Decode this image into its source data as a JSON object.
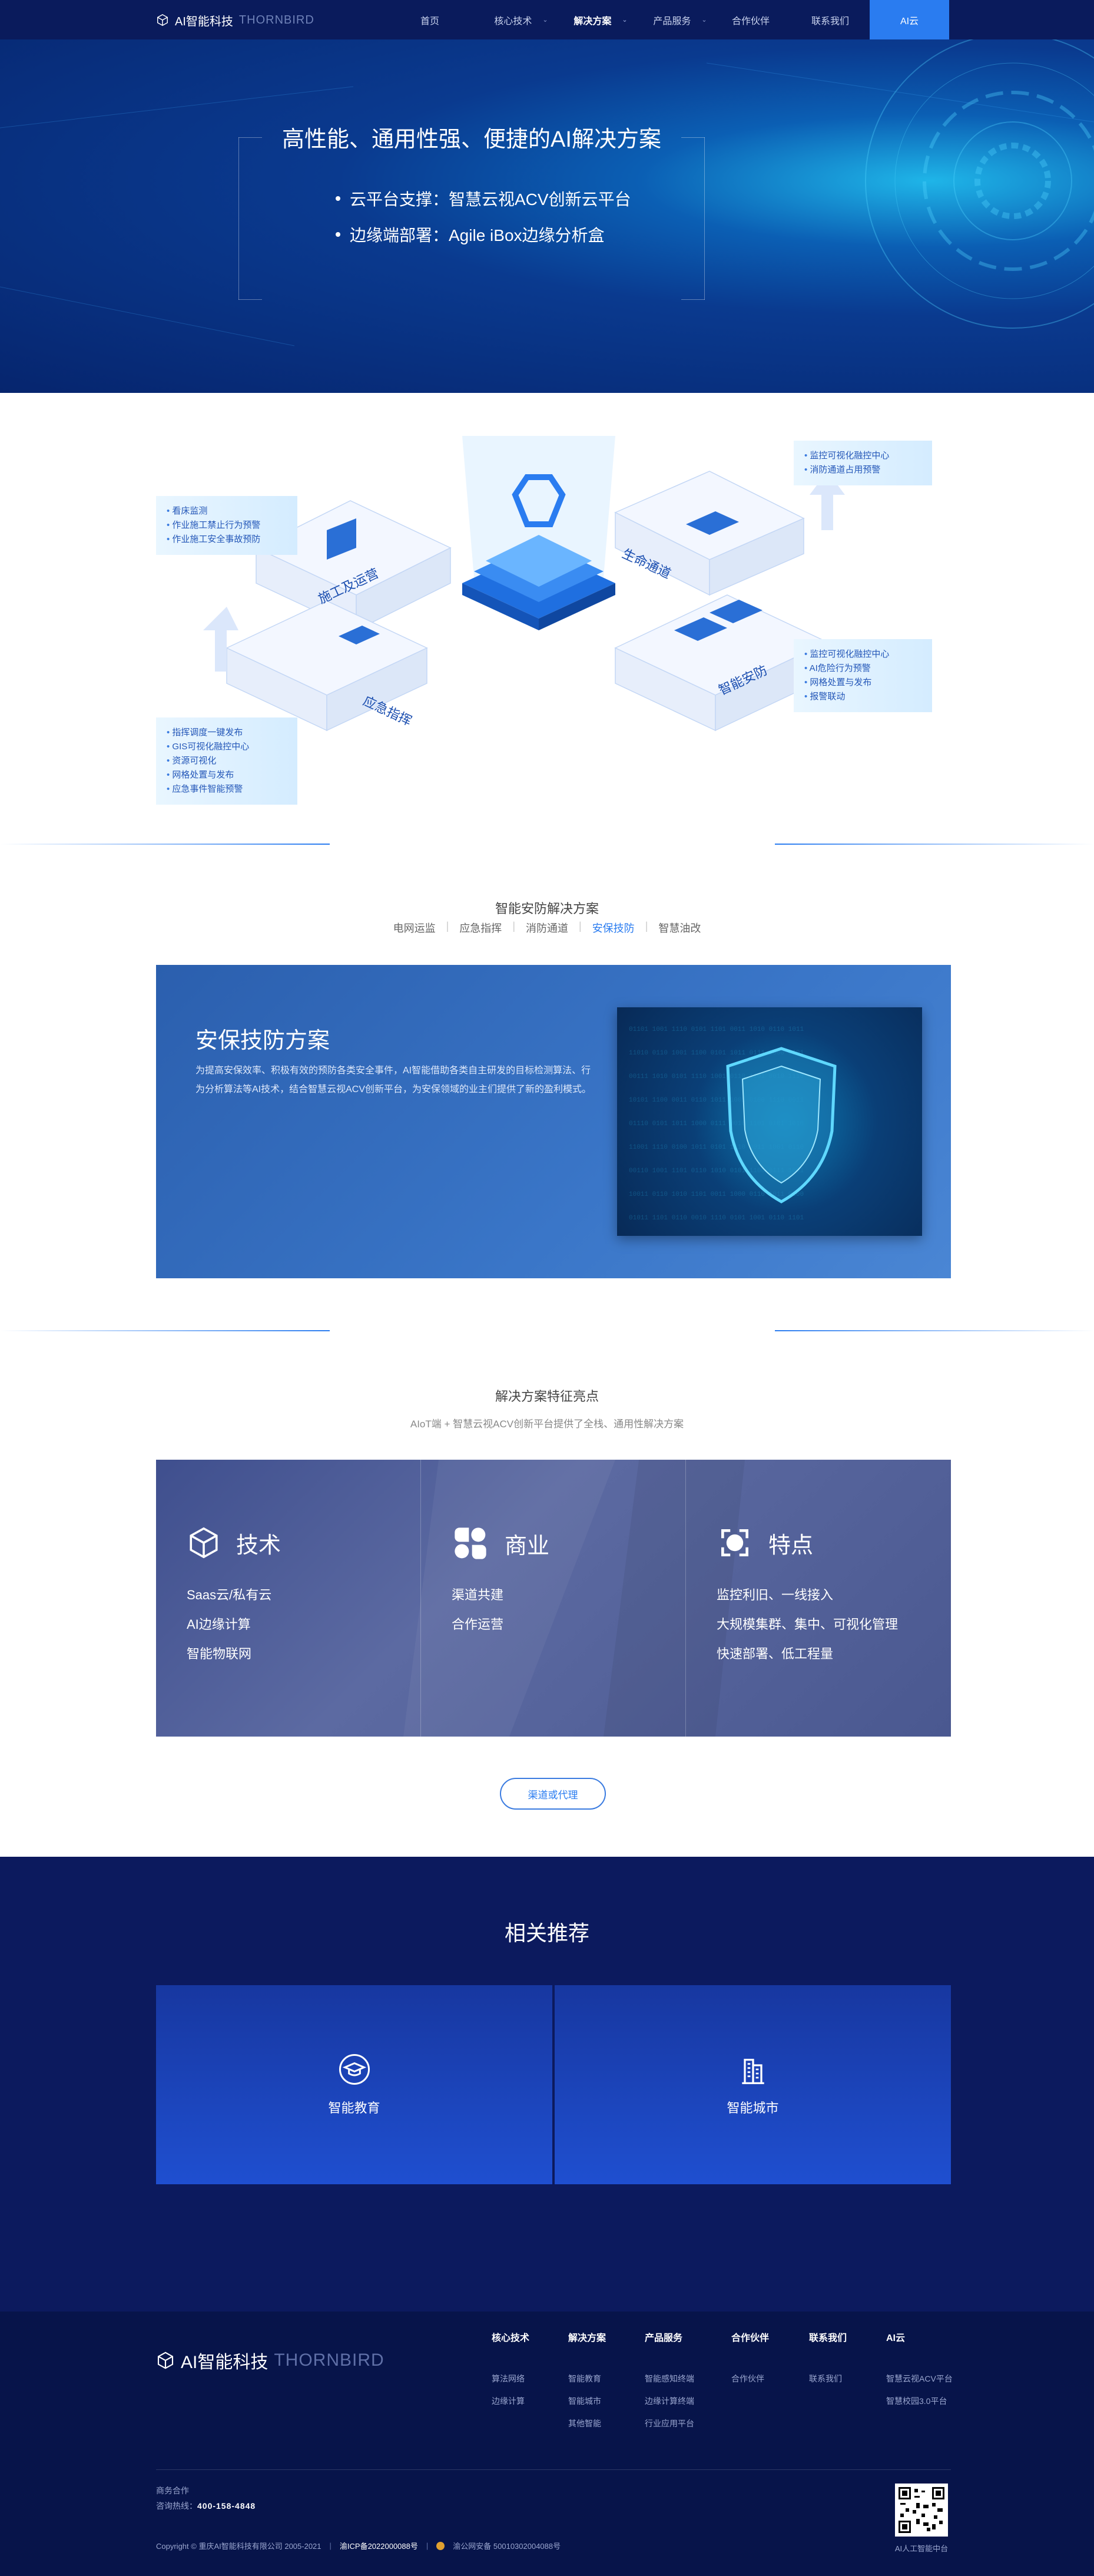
{
  "nav": {
    "logo_cn": "AI智能科技",
    "logo_en": "THORNBIRD",
    "items": [
      "首页",
      "核心技术",
      "解决方案",
      "产品服务",
      "合作伙伴",
      "联系我们",
      "AI云"
    ]
  },
  "hero": {
    "title": "高性能、通用性强、便捷的AI解决方案",
    "bullets": [
      "云平台支撑：智慧云视ACV创新云平台",
      "边缘端部署：Agile iBox边缘分析盒"
    ]
  },
  "diagram": {
    "labels": [
      "施工及运营",
      "生命通道",
      "应急指挥",
      "智能安防"
    ],
    "callout_top_left": [
      "看床监测",
      "作业施工禁止行为预警",
      "作业施工安全事故预防"
    ],
    "callout_top_right": [
      "监控可视化融控中心",
      "消防通道占用预警"
    ],
    "callout_bottom_left": [
      "指挥调度一键发布",
      "GIS可视化融控中心",
      "资源可视化",
      "网格处置与发布",
      "应急事件智能预警"
    ],
    "callout_bottom_right": [
      "监控可视化融控中心",
      "AI危险行为预警",
      "网格处置与发布",
      "报警联动"
    ]
  },
  "solutions": {
    "title": "智能安防解决方案",
    "tabs": [
      "电网运监",
      "应急指挥",
      "消防通道",
      "安保技防",
      "智慧油改"
    ],
    "active_tab": 3,
    "panel_title": "安保技防方案",
    "panel_desc": "为提高安保效率、积极有效的预防各类安全事件，AI智能借助各类自主研发的目标检测算法、行为分析算法等AI技术，结合智慧云视ACV创新平台，为安保领域的业主们提供了新的盈利模式。"
  },
  "features": {
    "title": "解决方案特征亮点",
    "subtitle": "AIoT端 + 智慧云视ACV创新平台提供了全栈、通用性解决方案",
    "cols": [
      {
        "name": "技术",
        "items": [
          "Saas云/私有云",
          "AI边缘计算",
          "智能物联网"
        ]
      },
      {
        "name": "商业",
        "items": [
          "渠道共建",
          "合作运营"
        ]
      },
      {
        "name": "特点",
        "items": [
          "监控利旧、一线接入",
          "大规模集群、集中、可视化管理",
          "快速部署、低工程量"
        ]
      }
    ],
    "cta": "渠道或代理"
  },
  "related": {
    "title": "相关推荐",
    "cards": [
      "智能教育",
      "智能城市"
    ]
  },
  "footer": {
    "logo_cn": "AI智能科技",
    "logo_en": "THORNBIRD",
    "cols": [
      {
        "h": "核心技术",
        "items": [
          "算法网络",
          "边缘计算"
        ]
      },
      {
        "h": "解决方案",
        "items": [
          "智能教育",
          "智能城市",
          "其他智能"
        ]
      },
      {
        "h": "产品服务",
        "items": [
          "智能感知终端",
          "边缘计算终端",
          "行业应用平台"
        ]
      },
      {
        "h": "合作伙伴",
        "items": [
          "合作伙伴"
        ]
      },
      {
        "h": "联系我们",
        "items": [
          "联系我们"
        ]
      },
      {
        "h": "AI云",
        "items": [
          "智慧云视ACV平台",
          "智慧校园3.0平台"
        ]
      }
    ],
    "coop": "商务合作",
    "hotline_label": "咨询热线：",
    "hotline": "400-158-4848",
    "copyright": "Copyright © 重庆AI智能科技有限公司 2005-2021",
    "icp": "渝ICP备2022000088号",
    "police": "渝公网安备 50010302004088号",
    "qr_label": "AI人工智能中台"
  }
}
